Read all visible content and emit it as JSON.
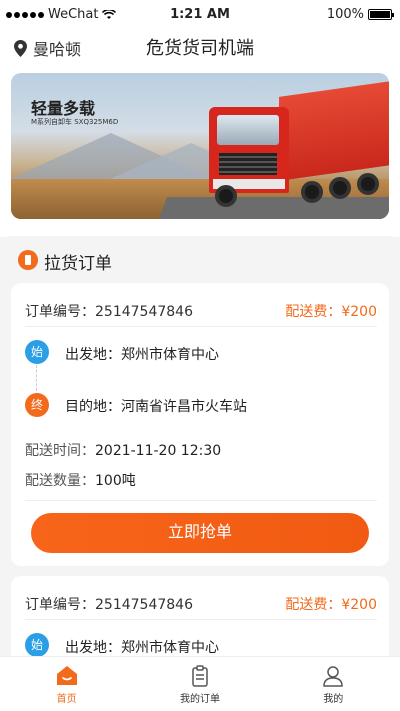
{
  "statusbar": {
    "carrier": "WeChat",
    "time": "1:21 AM",
    "battery": "100%"
  },
  "header": {
    "location": "曼哈顿",
    "title": "危货货司机端"
  },
  "banner": {
    "headline": "轻量多载",
    "subline": "M系列自卸车 SXQ325M6D"
  },
  "section": {
    "title": "拉货订单"
  },
  "orders": [
    {
      "order_no_label": "订单编号：",
      "order_no": "25147547846",
      "fee": "配送费：¥200",
      "start_badge": "始",
      "origin": "出发地：郑州市体育中心",
      "end_badge": "终",
      "destination": "目的地：河南省许昌市火车站",
      "time_label": "配送时间：",
      "time": "2021-11-20 12:30",
      "qty_label": "配送数量：",
      "qty": "100吨",
      "button": "立即抢单"
    },
    {
      "order_no_label": "订单编号：",
      "order_no": "25147547846",
      "fee": "配送费：¥200",
      "start_badge": "始",
      "origin": "出发地：郑州市体育中心"
    }
  ],
  "tabbar": {
    "home": "首页",
    "my_orders": "我的订单",
    "me": "我的"
  },
  "colors": {
    "accent": "#f26a1b",
    "start_badge": "#2b9fe6"
  }
}
